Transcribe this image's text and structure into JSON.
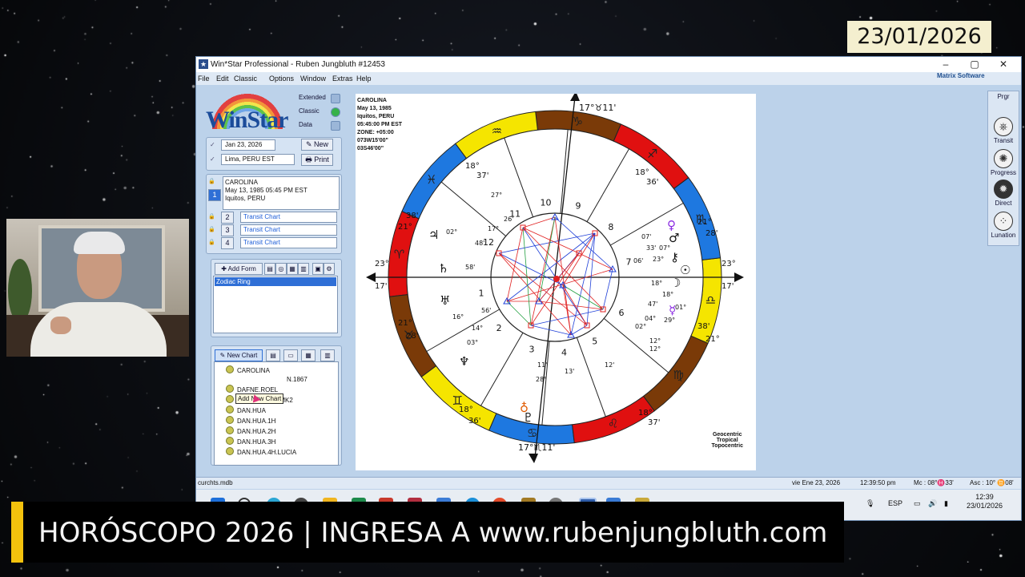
{
  "overlay": {
    "date_badge": "23/01/2026",
    "lower_third": "HORÓSCOPO 2026 | INGRESA A www.rubenjungbluth.com",
    "accent_color": "#f4c20d"
  },
  "window": {
    "title": "Win*Star Professional - Ruben Jungbluth #12453",
    "app_icon": "star-icon",
    "controls": [
      "minimize-icon",
      "maximize-icon",
      "close-icon"
    ]
  },
  "menu": {
    "items": [
      "File",
      "Edit",
      "Classic",
      "Options",
      "Window",
      "Extras",
      "Help"
    ],
    "brand": "Matrix Software"
  },
  "left_panel": {
    "logo_text": "WinStar",
    "modes": [
      "Extended",
      "Classic",
      "Data"
    ],
    "date_value": "Jan 23, 2026",
    "location_value": "Lima, PERU EST",
    "new_label": "New",
    "print_label": "Print",
    "slot1": {
      "number": "1",
      "name": "CAROLINA",
      "datetime": "May 13, 1985  05:45 PM EST",
      "place": "Iquitos, PERU"
    },
    "slots": [
      {
        "number": "2",
        "label": "Transit Chart"
      },
      {
        "number": "3",
        "label": "Transit Chart"
      },
      {
        "number": "4",
        "label": "Transit Chart"
      }
    ],
    "add_form_label": "Add Form",
    "forms_selected": "Zodiac Ring",
    "new_chart_label": "New Chart",
    "tooltip": "Add New Chart",
    "tree_items": [
      "CAROLINA",
      "N.1867",
      "DAFNE.ROEL",
      "DAFNE.ROEL.MK2",
      "DAN.HUA",
      "DAN.HUA.1H",
      "DAN.HUA.2H",
      "DAN.HUA.3H",
      "DAN.HUA.4H.LUCIA"
    ]
  },
  "chart": {
    "info": [
      "CAROLINA",
      "May 13, 1985",
      "Iquitos, PERU",
      "05:45:00 PM EST",
      "ZONE: +05:00",
      "073W15'00\"",
      "03S46'00\""
    ],
    "footer": [
      "Geocentric",
      "Tropical",
      "Topocentric"
    ],
    "mc_label": "17°♉11'",
    "ic_label": "17°♏11'",
    "asc_deg": "23°",
    "asc_min": "17'",
    "dsc_deg": "23°",
    "dsc_min": "17'",
    "sign_colors": {
      "fire": "#e01010",
      "earth": "#7a3a08",
      "air": "#f5e500",
      "water": "#1e78e0"
    },
    "house_numbers": [
      "1",
      "2",
      "3",
      "4",
      "5",
      "6",
      "7",
      "8",
      "9",
      "10",
      "11",
      "12"
    ],
    "cusp_labels": [
      "18°",
      "37'",
      "18°",
      "36'",
      "21°",
      "28'",
      "38'",
      "21°",
      "21°",
      "28'",
      "38'",
      "21°",
      "18°",
      "36'",
      "18°",
      "37'"
    ],
    "planet_labels": [
      "27°",
      "26'",
      "02°",
      "17°",
      "48'",
      "58'",
      "56'",
      "16°",
      "14°",
      "03°",
      "11'",
      "28°",
      "13'",
      "12'",
      "12°",
      "07'",
      "07°",
      "33'",
      "06'",
      "23°",
      "18°",
      "18°",
      "47'",
      "01°",
      "29°",
      "04°",
      "02°",
      "12°"
    ],
    "planet_glyphs": [
      "♀",
      "♂",
      "☉",
      "☽",
      "☿",
      "♃",
      "♄",
      "♅",
      "♆",
      "♇",
      "⚷",
      "♁"
    ]
  },
  "right_bar": {
    "title": "Prgr",
    "buttons": [
      "Transit",
      "Progress",
      "Direct",
      "Lunation"
    ],
    "icons": [
      "transit-wheel-icon",
      "progress-wheel-icon",
      "direct-wheel-icon",
      "lunation-wheel-icon"
    ]
  },
  "status": {
    "file": "curchts.mdb",
    "date": "vie  Ene 23, 2026",
    "time": "12:39:50 pm",
    "mc": "Mc : 08°♓33'",
    "asc": "Asc : 10° ♊08'"
  },
  "taskbar": {
    "lang": "ESP",
    "clock_time": "12:39",
    "clock_date": "23/01/2026"
  }
}
